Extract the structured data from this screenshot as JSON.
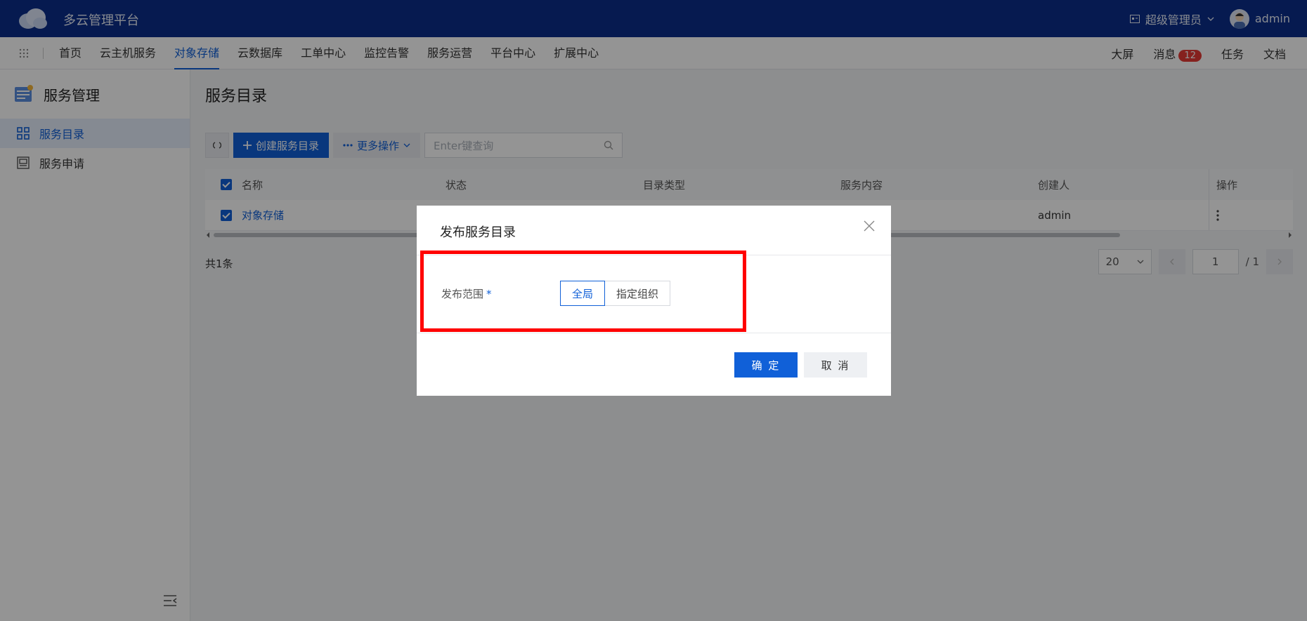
{
  "app": {
    "title": "多云管理平台"
  },
  "user": {
    "role": "超级管理员",
    "name": "admin"
  },
  "nav": {
    "items": [
      "首页",
      "云主机服务",
      "对象存储",
      "云数据库",
      "工单中心",
      "监控告警",
      "服务运营",
      "平台中心",
      "扩展中心"
    ],
    "active": "对象存储",
    "right": {
      "screen": "大屏",
      "messages": "消息",
      "message_count": "12",
      "tasks": "任务",
      "docs": "文档"
    }
  },
  "sidebar": {
    "title": "服务管理",
    "items": [
      {
        "label": "服务目录",
        "active": true
      },
      {
        "label": "服务申请",
        "active": false
      }
    ]
  },
  "page": {
    "title": "服务目录"
  },
  "toolbar": {
    "create_label": "创建服务目录",
    "more_label": "更多操作",
    "search_placeholder": "Enter键查询"
  },
  "table": {
    "headers": [
      "名称",
      "状态",
      "目录类型",
      "服务内容",
      "创建人",
      "操作"
    ],
    "rows": [
      {
        "name": "对象存储",
        "status": "",
        "type": "",
        "content": "",
        "creator": "admin"
      }
    ]
  },
  "footer": {
    "total": "共1条",
    "page_size": "20",
    "page": "1",
    "page_total": "/ 1"
  },
  "modal": {
    "title": "发布服务目录",
    "field_label": "发布范围",
    "required_mark": "*",
    "options": [
      "全局",
      "指定组织"
    ],
    "selected": "全局",
    "ok_label": "确 定",
    "cancel_label": "取 消"
  }
}
